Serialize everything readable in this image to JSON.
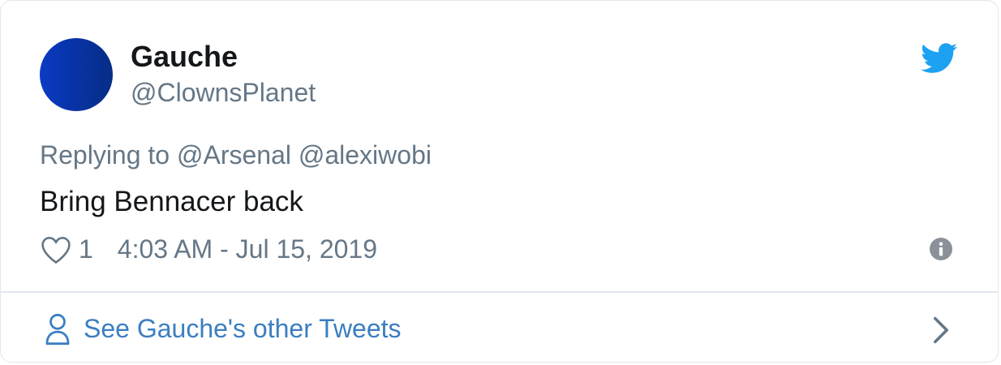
{
  "user": {
    "display_name": "Gauche",
    "handle": "@ClownsPlanet"
  },
  "tweet": {
    "replying_to": "Replying to @Arsenal @alexiwobi",
    "text": "Bring Bennacer back",
    "likes": "1",
    "timestamp": "4:03 AM - Jul 15, 2019"
  },
  "footer": {
    "other_tweets_label": "See Gauche's other Tweets"
  },
  "icons": {
    "brand": "twitter-bird-icon",
    "like": "heart-icon",
    "info": "info-icon",
    "person": "person-icon",
    "next": "chevron-right-icon"
  },
  "colors": {
    "twitter_blue": "#1da1f2",
    "link_blue": "#3b7ec1",
    "secondary_text": "#657786",
    "primary_text": "#14171a"
  }
}
